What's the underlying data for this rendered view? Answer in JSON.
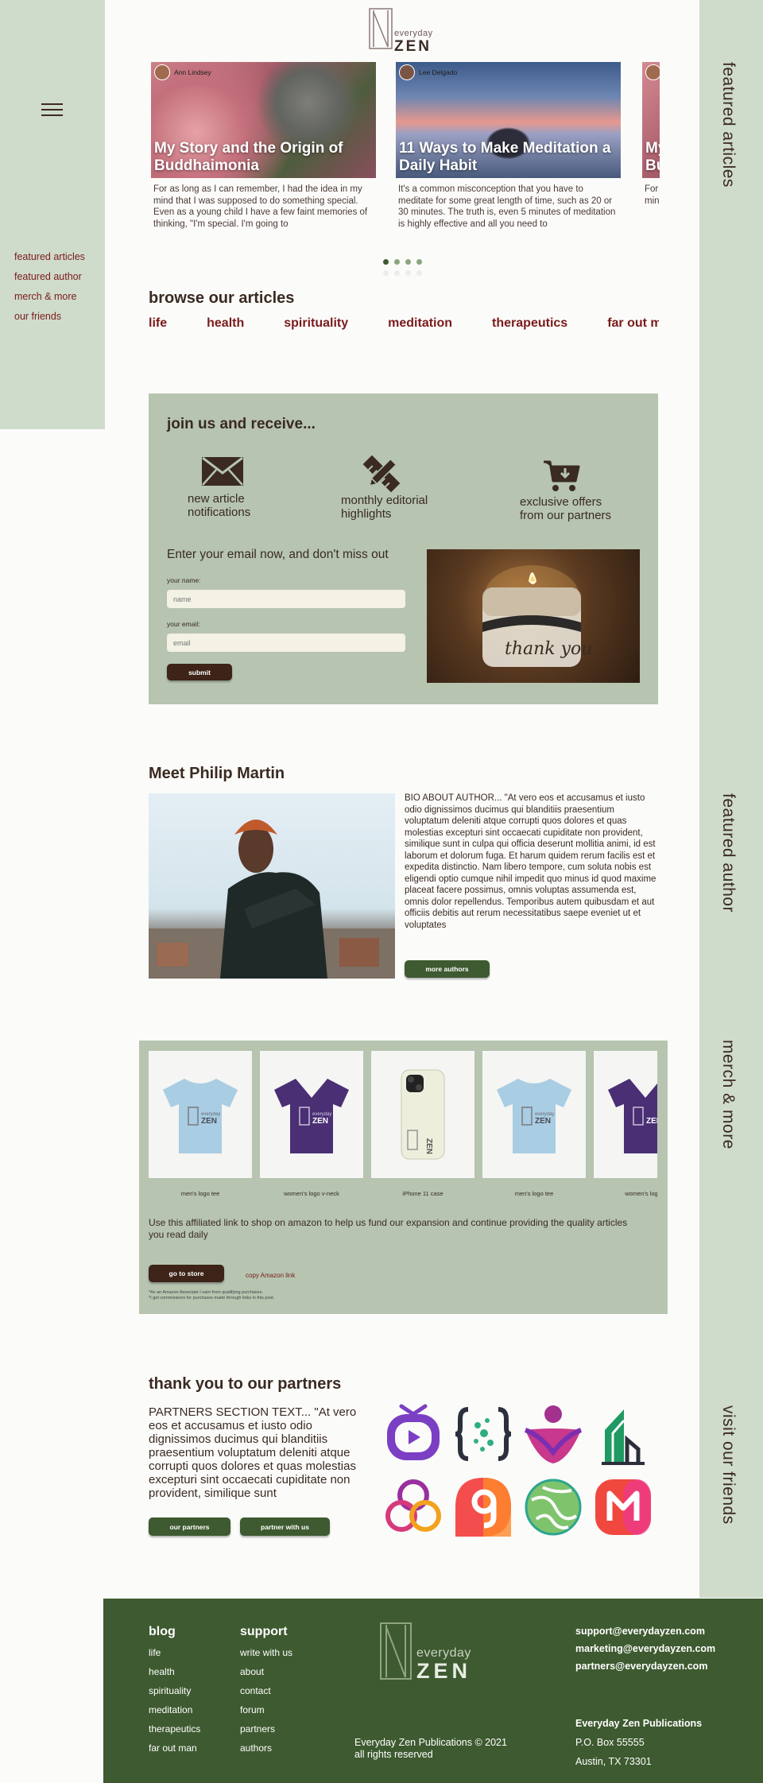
{
  "brand": {
    "top": "everyday",
    "bottom": "ZEN"
  },
  "left_nav": {
    "items": [
      "featured articles",
      "featured author",
      "merch & more",
      "our friends"
    ]
  },
  "right_labels": [
    "featured articles",
    "featured author",
    "merch & more",
    "visit our friends"
  ],
  "articles": [
    {
      "author": "Ann Lindsey",
      "title": "My Story and the Origin of Buddhaimonia",
      "excerpt": "For as long as I can remember, I had the idea in my mind that I was supposed to do something special. Even as a young child I have a few faint memories of thinking, \"I'm special. I'm going to"
    },
    {
      "author": "Lee Delgado",
      "title": "11 Ways to Make Meditation a Daily Habit",
      "excerpt": "It's a common misconception that you have to meditate for some great length of time, such as 20 or 30 minutes. The truth is, even 5 minutes of meditation is highly effective and all you need to"
    },
    {
      "author": "",
      "title": "My Story and the Origin of Buddhaimonia",
      "excerpt": "For as long as I can remember, I had the idea in my mind that I was supposed to do something special."
    }
  ],
  "browse": {
    "heading": "browse our articles",
    "categories": [
      "life",
      "health",
      "spirituality",
      "meditation",
      "therapeutics",
      "far out man"
    ]
  },
  "join": {
    "heading": "join us and receive...",
    "benefits": [
      {
        "icon": "envelope-icon",
        "line1": "new article",
        "line2": "notifications"
      },
      {
        "icon": "pencil-ruler-icon",
        "line1": "monthly editorial",
        "line2": "highlights"
      },
      {
        "icon": "cart-icon",
        "line1": "exclusive offers",
        "line2": "from our partners"
      }
    ],
    "email_heading": "Enter your email now, and don't miss out",
    "name_label": "your name:",
    "name_placeholder": "name",
    "email_label": "your email:",
    "email_placeholder": "email",
    "submit": "submit",
    "candle_text": "thank you"
  },
  "author": {
    "prefix": "Meet ",
    "name": "Philip Martin",
    "bio": "BIO ABOUT AUTHOR... \"At vero eos et accusamus et iusto odio dignissimos ducimus qui blanditiis praesentium voluptatum deleniti atque corrupti quos dolores et quas molestias excepturi sint occaecati cupiditate non provident, similique sunt in culpa qui officia deserunt mollitia animi, id est laborum et dolorum fuga. Et harum quidem rerum facilis est et expedita distinctio. Nam libero tempore, cum soluta nobis est eligendi optio cumque nihil impedit quo minus id quod maxime placeat facere possimus, omnis voluptas assumenda est, omnis dolor repellendus. Temporibus autem quibusdam et aut officiis debitis aut rerum necessitatibus saepe eveniet ut et voluptates",
    "button": "more authors"
  },
  "merch": {
    "products": [
      {
        "label": "men's logo tee",
        "color": "#a9cde3"
      },
      {
        "label": "women's logo v-neck",
        "color": "#4a2f74"
      },
      {
        "label": "iPhone 11 case",
        "color": "#eeeedd"
      },
      {
        "label": "men's logo tee",
        "color": "#a9cde3"
      },
      {
        "label": "women's logo v",
        "color": "#4a2f74"
      }
    ],
    "text": "Use this affiliated link to shop on amazon to help us fund our expansion and continue providing the quality articles you read daily",
    "button": "go to store",
    "copy_link": "copy Amazon link",
    "fine1": "*As an Amazon Associate I earn from qualifying purchases.",
    "fine2": "*I get commissions for purchases made through links in this post."
  },
  "partners": {
    "heading": "thank you to our partners",
    "text": "PARTNERS SECTION TEXT... \"At vero eos et accusamus et iusto odio dignissimos ducimus qui blanditiis praesentium voluptatum deleniti atque corrupti quos dolores et quas molestias excepturi sint occaecati cupiditate non provident, similique sunt",
    "button1": "our partners",
    "button2": "partner with us"
  },
  "footer": {
    "blog_heading": "blog",
    "blog_links": [
      "life",
      "health",
      "spirituality",
      "meditation",
      "therapeutics",
      "far out man"
    ],
    "support_heading": "support",
    "support_links": [
      "write with us",
      "about",
      "contact",
      "forum",
      "partners",
      "authors"
    ],
    "emails": [
      "support@everydayzen.com",
      "marketing@everydayzen.com",
      "partners@everydayzen.com"
    ],
    "company": "Everyday Zen Publications",
    "address1": "P.O. Box 55555",
    "address2": "Austin, TX 73301",
    "copyright1": "Everyday Zen Publications © 2021",
    "copyright2": "all rights reserved"
  },
  "colors": {
    "sage": "#cfdbcb",
    "panel": "#b6c4b0",
    "forest": "#3e5a30",
    "maroon": "#7a1b1b",
    "dark_brown": "#3d2318"
  }
}
